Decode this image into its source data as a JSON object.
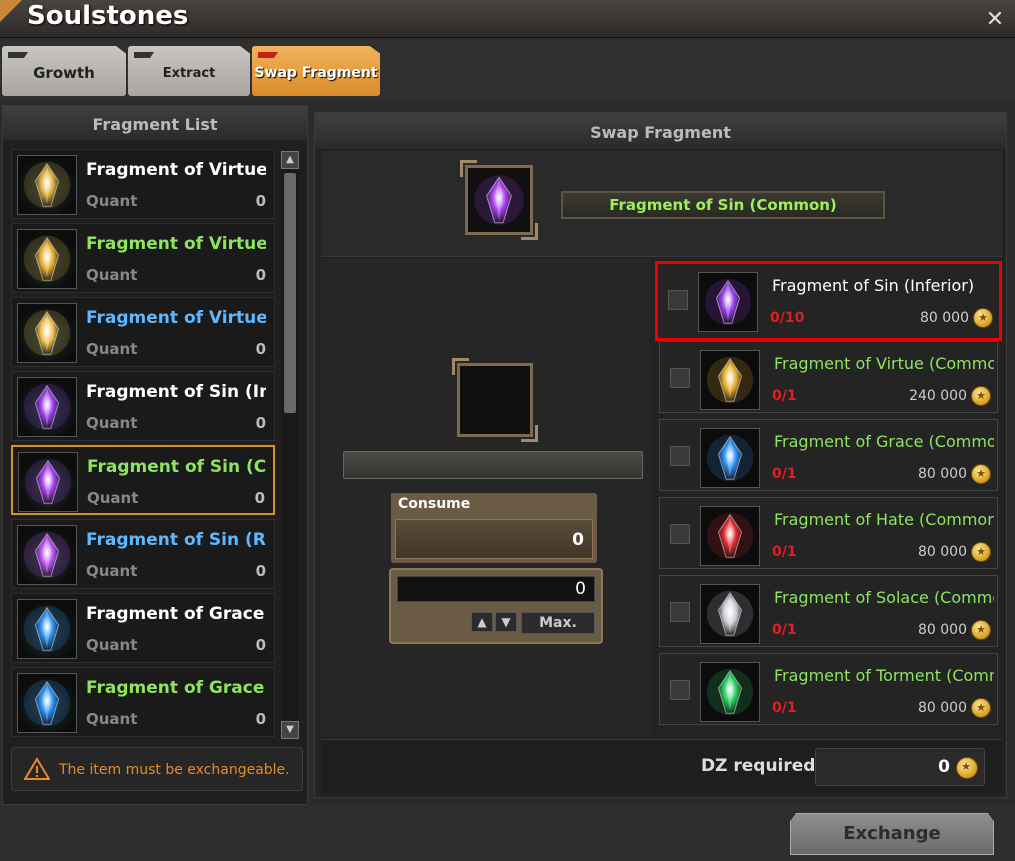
{
  "window": {
    "title": "Soulstones",
    "close_icon": "close-icon"
  },
  "tabs": [
    {
      "label": "Growth",
      "active": false
    },
    {
      "label": "Extract Fragment",
      "active": false
    },
    {
      "label": "Swap Fragment",
      "active": true
    }
  ],
  "fragment_list": {
    "header": "Fragment List",
    "items": [
      {
        "name": "Fragment of Virtue (Inferior)",
        "qty_label": "Quantity",
        "qty": "0",
        "color": "#ffffff",
        "gem": "#e0b040"
      },
      {
        "name": "Fragment of Virtue (Common)",
        "qty_label": "Quantity",
        "qty": "0",
        "color": "#8fe45e",
        "gem": "#e8b030"
      },
      {
        "name": "Fragment of Virtue (Refined)",
        "qty_label": "Quantity",
        "qty": "0",
        "color": "#5fb8ff",
        "gem": "#f2c050"
      },
      {
        "name": "Fragment of Sin (Inferior)",
        "qty_label": "Quantity",
        "qty": "0",
        "color": "#ffffff",
        "gem": "#9a3ff0"
      },
      {
        "name": "Fragment of Sin (Common)",
        "qty_label": "Quantity",
        "qty": "0",
        "color": "#8fe45e",
        "gem": "#a93ff0",
        "selected": true
      },
      {
        "name": "Fragment of Sin (Refined)",
        "qty_label": "Quantity",
        "qty": "0",
        "color": "#5fb8ff",
        "gem": "#b94ff5"
      },
      {
        "name": "Fragment of Grace (Inferior)",
        "qty_label": "Quantity",
        "qty": "0",
        "color": "#ffffff",
        "gem": "#2a8ff0"
      },
      {
        "name": "Fragment of Grace (Common)",
        "qty_label": "Quantity",
        "qty": "0",
        "color": "#8fe45e",
        "gem": "#2a90f5"
      }
    ],
    "notice": "The item must be exchangeable."
  },
  "swap": {
    "header": "Swap Fragment",
    "target_name": "Fragment of Sin (Common)",
    "consume_label": "Consume",
    "consume_value": "0",
    "quantity_value": "0",
    "max_label": "Max.",
    "options": [
      {
        "name": "Fragment of Sin (Inferior)",
        "count": "0/10",
        "cost": "80 000",
        "color": "#ffffff",
        "gem": "#9a3ff0",
        "highlight": true
      },
      {
        "name": "Fragment of Virtue (Common)",
        "count": "0/1",
        "cost": "240 000",
        "color": "#8fe45e",
        "gem": "#e8b030"
      },
      {
        "name": "Fragment of Grace (Common)",
        "count": "0/1",
        "cost": "80 000",
        "color": "#8fe45e",
        "gem": "#2a90f5"
      },
      {
        "name": "Fragment of Hate (Common)",
        "count": "0/1",
        "cost": "80 000",
        "color": "#8fe45e",
        "gem": "#e02a30"
      },
      {
        "name": "Fragment of Solace (Common)",
        "count": "0/1",
        "cost": "80 000",
        "color": "#8fe45e",
        "gem": "#cfcfd8"
      },
      {
        "name": "Fragment of Torment (Common)",
        "count": "0/1",
        "cost": "80 000",
        "color": "#8fe45e",
        "gem": "#2ad060"
      }
    ],
    "dz_label": "DZ required",
    "dz_value": "0"
  },
  "exchange_label": "Exchange"
}
